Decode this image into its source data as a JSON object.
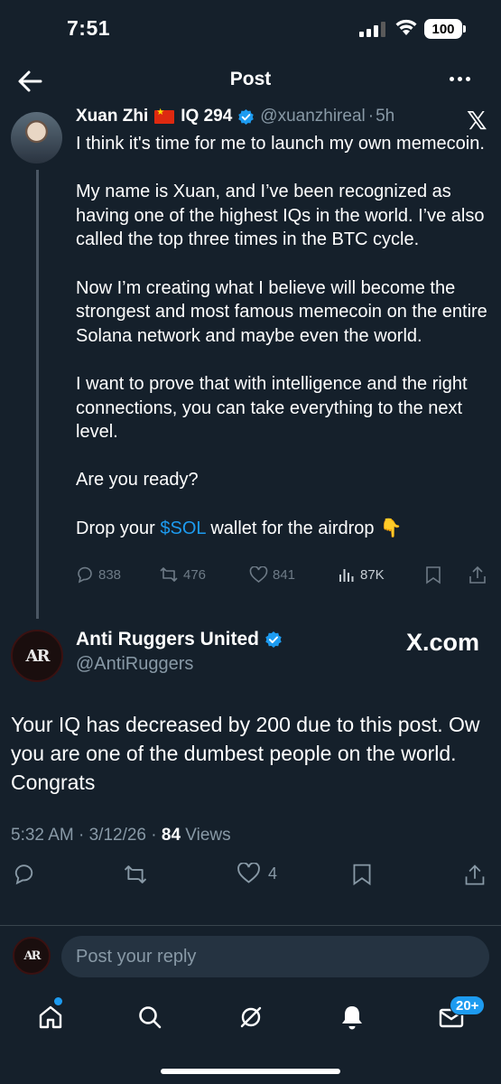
{
  "status_bar": {
    "time": "7:51",
    "battery": "100"
  },
  "header": {
    "title": "Post"
  },
  "quoted_tweet": {
    "author_name": "Xuan Zhi",
    "author_suffix": "IQ 294",
    "handle": "@xuanzhireal",
    "time": "5h",
    "paragraphs": [
      "I think it's time for me to launch my own memecoin.",
      "My name is Xuan, and I’ve been recognized as having one of the highest IQs in the world. I’ve also called the top three times in the BTC cycle.",
      "Now I’m creating what I believe will become the strongest and most famous memecoin on the entire Solana network and maybe even the world.",
      "I want to prove that with intelligence and the right connections, you can take everything to the next level.",
      "Are you ready?"
    ],
    "last_line_prefix": "Drop your ",
    "last_line_link": "$SOL",
    "last_line_suffix": " wallet for the airdrop",
    "stats": {
      "replies": "838",
      "retweets": "476",
      "likes": "841",
      "views": "87K"
    }
  },
  "main_tweet": {
    "author_name": "Anti Ruggers United",
    "handle": "@AntiRuggers",
    "source_label": "X.com",
    "avatar_text": "AR",
    "body": "Your IQ has decreased by 200 due to this post. Ow you are one of the dumbest people on the world. Congrats",
    "timestamp": "5:32 AM · 3/12/26 · ",
    "views_count": "84",
    "views_label": " Views",
    "likes": "4"
  },
  "reply_bar": {
    "placeholder": "Post your reply"
  },
  "bottom_nav": {
    "messages_badge": "20+"
  },
  "colors": {
    "background": "#15202b",
    "accent": "#1d9bf0",
    "muted": "#8899a6"
  }
}
